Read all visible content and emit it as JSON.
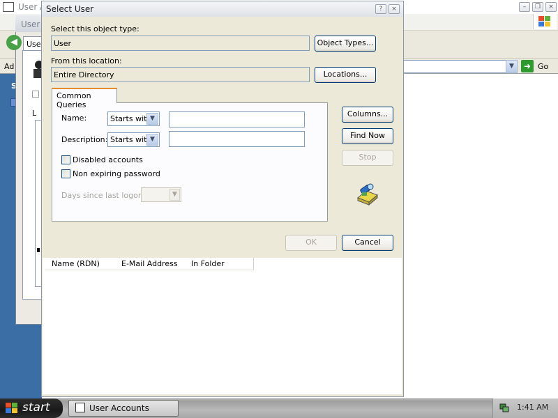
{
  "outer_window": {
    "title": "User A",
    "address_label": "Ad",
    "go_label": "Go"
  },
  "inner_window": {
    "title": "User A",
    "tab": "User",
    "sidebar_label": "S",
    "list_label": "L"
  },
  "dialog": {
    "title": "Select User",
    "object_type": {
      "label": "Select this object type:",
      "value": "User",
      "button": "Object Types..."
    },
    "location": {
      "label": "From this location:",
      "value": "Entire Directory",
      "button": "Locations..."
    },
    "tab": "Common Queries",
    "name": {
      "label": "Name:",
      "mode": "Starts with",
      "value": ""
    },
    "description": {
      "label": "Description:",
      "mode": "Starts with",
      "value": ""
    },
    "disabled_accounts": {
      "label": "Disabled accounts",
      "checked": false
    },
    "non_expiring": {
      "label": "Non expiring password",
      "checked": false
    },
    "days_since_logon": {
      "label": "Days since last logon:",
      "value": ""
    },
    "buttons": {
      "columns": "Columns...",
      "find_now": "Find Now",
      "stop": "Stop",
      "ok": "OK",
      "cancel": "Cancel"
    },
    "results": {
      "columns": [
        "Name (RDN)",
        "E-Mail Address",
        "In Folder"
      ],
      "rows": []
    }
  },
  "taskbar": {
    "start": "start",
    "task_item": "User Accounts",
    "clock": "1:41 AM"
  },
  "colors": {
    "desktop": "#3a6ea5",
    "dialog_face": "#ece9d8",
    "accent_tab": "#e68b2c",
    "button_border": "#003c74"
  }
}
